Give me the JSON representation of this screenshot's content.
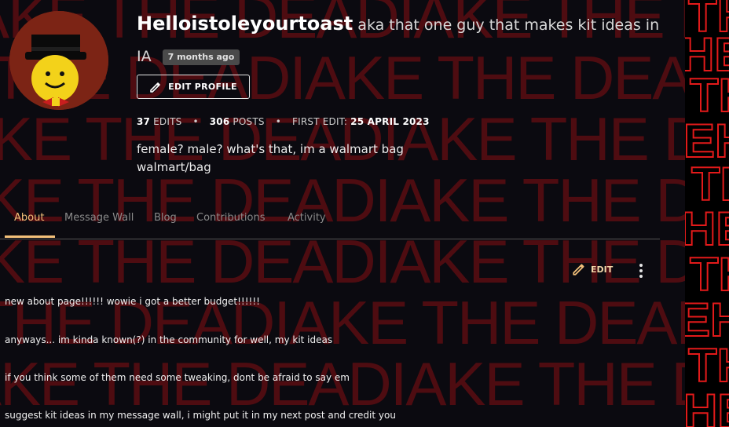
{
  "profile": {
    "username": "Helloistoleyourtoast",
    "tagline": "aka that one guy that makes kit ideas in IA",
    "joined_badge": "7 months ago",
    "edit_profile_label": "EDIT PROFILE",
    "stats": {
      "edits_count": "37",
      "edits_label": "EDITS",
      "posts_count": "306",
      "posts_label": "POSTS",
      "first_edit_label": "FIRST EDIT:",
      "first_edit_date": "25 APRIL 2023"
    },
    "bio_line1": "female? male? what's that, im a walmart bag",
    "bio_line2": "walmart/bag"
  },
  "tabs": [
    {
      "label": "About",
      "active": true
    },
    {
      "label": "Message Wall",
      "active": false
    },
    {
      "label": "Blog",
      "active": false
    },
    {
      "label": "Contributions",
      "active": false
    },
    {
      "label": "Activity",
      "active": false
    }
  ],
  "about": {
    "edit_label": "EDIT",
    "lines": [
      "new about page!!!!!! wowie i got a better budget!!!!!!",
      "anyways... im kinda known(?) in the community for well, my kit ideas",
      "if you think some of them need some tweaking, dont be afraid to say em",
      "suggest kit ideas in my message wall, i might put it in my next post and credit you"
    ]
  },
  "colors": {
    "accent": "#f2c07a",
    "background": "#0b0a10",
    "pattern": "#5a0d12",
    "strip": "#e31a1a"
  },
  "icons": [
    "pencil-icon",
    "kebab-menu-icon"
  ]
}
